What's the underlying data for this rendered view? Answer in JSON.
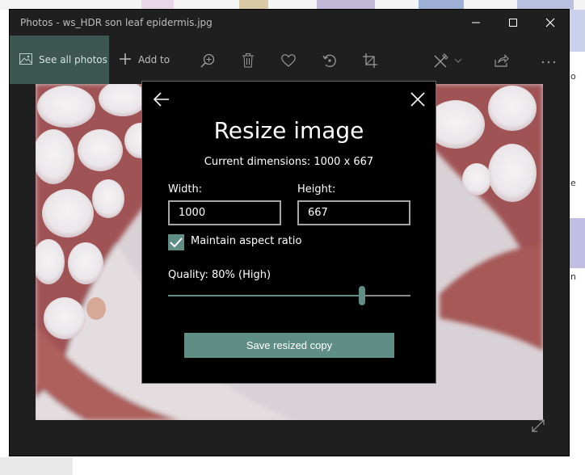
{
  "window": {
    "title": "Photos - ws_HDR son leaf epidermis.jpg"
  },
  "toolbar": {
    "see_all_photos": "See all photos",
    "add_to": "Add to",
    "icons": [
      "zoom-in-icon",
      "delete-icon",
      "favorite-heart-icon",
      "rotate-icon",
      "crop-icon",
      "edit-draw-icon",
      "share-icon",
      "more-icon"
    ]
  },
  "dialog": {
    "title": "Resize image",
    "current_dimensions": "Current dimensions: 1000 x 667",
    "width_label": "Width:",
    "width_value": "1000",
    "height_label": "Height:",
    "height_value": "667",
    "maintain_aspect_label": "Maintain aspect ratio",
    "maintain_aspect_checked": true,
    "quality_label": "Quality: 80% (High)",
    "quality_value": 80,
    "save_button": "Save resized copy"
  },
  "background": {
    "side_letter_1": "o",
    "side_letter_2": "e",
    "side_letter_3": "n"
  },
  "colors": {
    "accent": "#5f8f84",
    "see_all_bg": "#3b5750",
    "window_bg": "#1f1f1f",
    "dialog_bg": "#000000",
    "tissue_red": "#8e2a2a"
  }
}
